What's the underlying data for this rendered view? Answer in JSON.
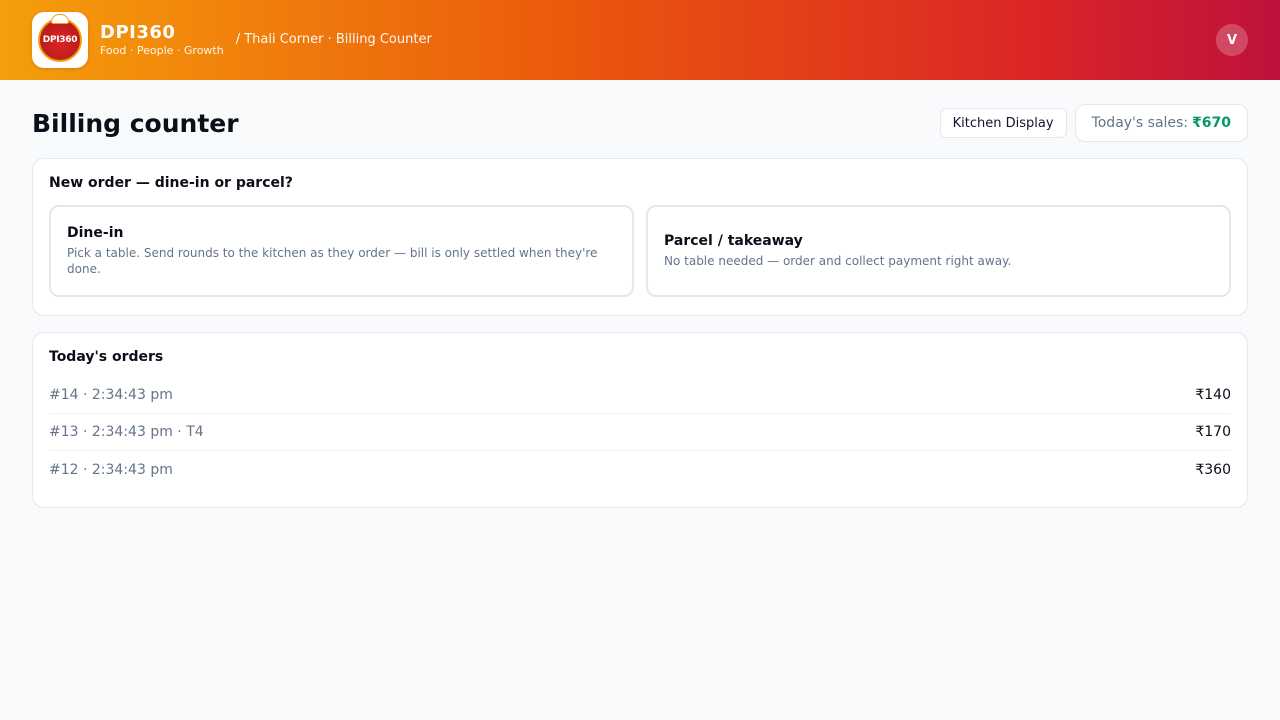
{
  "header": {
    "logo_text": "DPI360",
    "brand_name": "DPI360",
    "tagline": "Food · People · Growth",
    "breadcrumb": "/ Thali Corner · Billing Counter",
    "avatar_initial": "V",
    "gradient_colors": [
      "#f59e0b",
      "#ea580c",
      "#dc2626",
      "#be123c"
    ]
  },
  "page": {
    "title": "Billing counter",
    "kitchen_display_label": "Kitchen Display",
    "sales_label": "Today's sales:",
    "sales_value": "₹670",
    "sales_color": "#059669"
  },
  "new_order": {
    "title": "New order — dine-in or parcel?",
    "options": [
      {
        "title": "Dine-in",
        "description": "Pick a table. Send rounds to the kitchen as they order — bill is only settled when they're done."
      },
      {
        "title": "Parcel / takeaway",
        "description": "No table needed — order and collect payment right away."
      }
    ]
  },
  "orders": {
    "title": "Today's orders",
    "rows": [
      {
        "label": "#14 · 2:34:43 pm",
        "amount": "₹140"
      },
      {
        "label": "#13 · 2:34:43 pm · T4",
        "amount": "₹170"
      },
      {
        "label": "#12 · 2:34:43 pm",
        "amount": "₹360"
      }
    ]
  }
}
